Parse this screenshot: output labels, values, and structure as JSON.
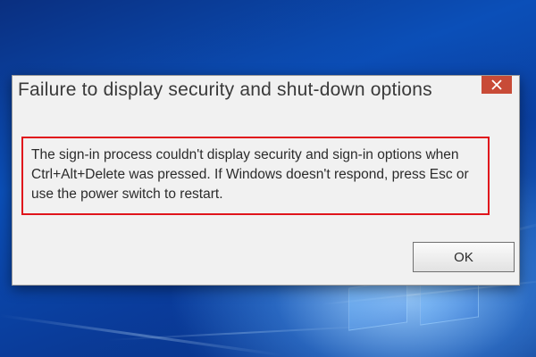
{
  "dialog": {
    "title": "Failure to display security and shut-down options",
    "message": "The sign-in process couldn't display security and sign-in options when Ctrl+Alt+Delete was pressed. If Windows doesn't respond, press Esc or use the power switch to restart.",
    "ok_label": "OK",
    "close_icon": "close-icon"
  },
  "colors": {
    "close_button": "#c84b37",
    "highlight_border": "#e0141c",
    "dialog_background": "#f1f1f1",
    "desktop_blue": "#0b4fb8"
  }
}
